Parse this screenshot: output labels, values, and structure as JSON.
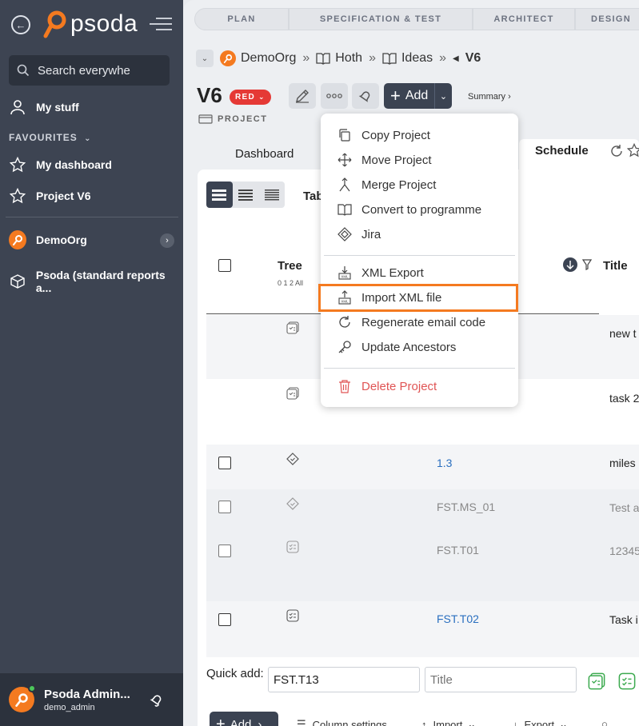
{
  "sidebar": {
    "logo_text": "psoda",
    "search_placeholder": "Search everywhe",
    "my_stuff": "My stuff",
    "favourites_label": "FAVOURITES",
    "fav_items": [
      "My dashboard",
      "Project V6"
    ],
    "org": "DemoOrg",
    "reports": "Psoda (standard reports a...",
    "user_name": "Psoda Admin...",
    "user_handle": "demo_admin"
  },
  "phases": [
    "PLAN",
    "SPECIFICATION & TEST",
    "ARCHITECT",
    "DESIGN"
  ],
  "breadcrumb": {
    "items": [
      "DemoOrg",
      "Hoth",
      "Ideas"
    ],
    "current": "V6",
    "separator": "»"
  },
  "project": {
    "title": "V6",
    "status": "RED",
    "type_label": "PROJECT",
    "add_label": "Add",
    "summary_label": "Summary ›"
  },
  "tabs": {
    "dashboard": "Dashboard",
    "schedule": "Schedule",
    "table_label": "Tab"
  },
  "table": {
    "tree_header": "Tree",
    "tree_levels": "0 1 2 All",
    "title_header": "Title",
    "rows": [
      {
        "id": "",
        "title": "new t",
        "icon": "task-list-icon",
        "checkbox": false,
        "id_color": "#2a6fbf"
      },
      {
        "id": "",
        "title": "task 2",
        "icon": "task-list-icon",
        "checkbox": false,
        "id_color": "#2a6fbf"
      },
      {
        "id": "1.3",
        "title": "miles",
        "icon": "milestone-icon",
        "checkbox": true,
        "id_color": "#2a6fbf"
      },
      {
        "id": "FST.MS_01",
        "title": "Test a",
        "icon": "milestone-icon",
        "checkbox": true,
        "id_color": "#888888"
      },
      {
        "id": "FST.T01",
        "title": "12345",
        "icon": "task-icon",
        "checkbox": true,
        "id_color": "#888888"
      },
      {
        "id": "FST.T02",
        "title": "Task i",
        "icon": "task-icon",
        "checkbox": true,
        "id_color": "#2a6fbf"
      }
    ]
  },
  "quick_add": {
    "label": "Quick add:",
    "id_value": "FST.T13",
    "title_placeholder": "Title"
  },
  "bottom_bar": {
    "add": "Add",
    "column_settings": "Column settings",
    "import": "Import",
    "export": "Export"
  },
  "menu": {
    "group1": [
      "Copy Project",
      "Move Project",
      "Merge Project",
      "Convert to programme",
      "Jira"
    ],
    "group2": [
      "XML Export",
      "Import XML file",
      "Regenerate email code",
      "Update Ancestors"
    ],
    "danger": "Delete Project"
  },
  "colors": {
    "accent": "#f47a20",
    "sidebar": "#3d4452",
    "status_red": "#e53935",
    "highlight": "#f47a20"
  }
}
